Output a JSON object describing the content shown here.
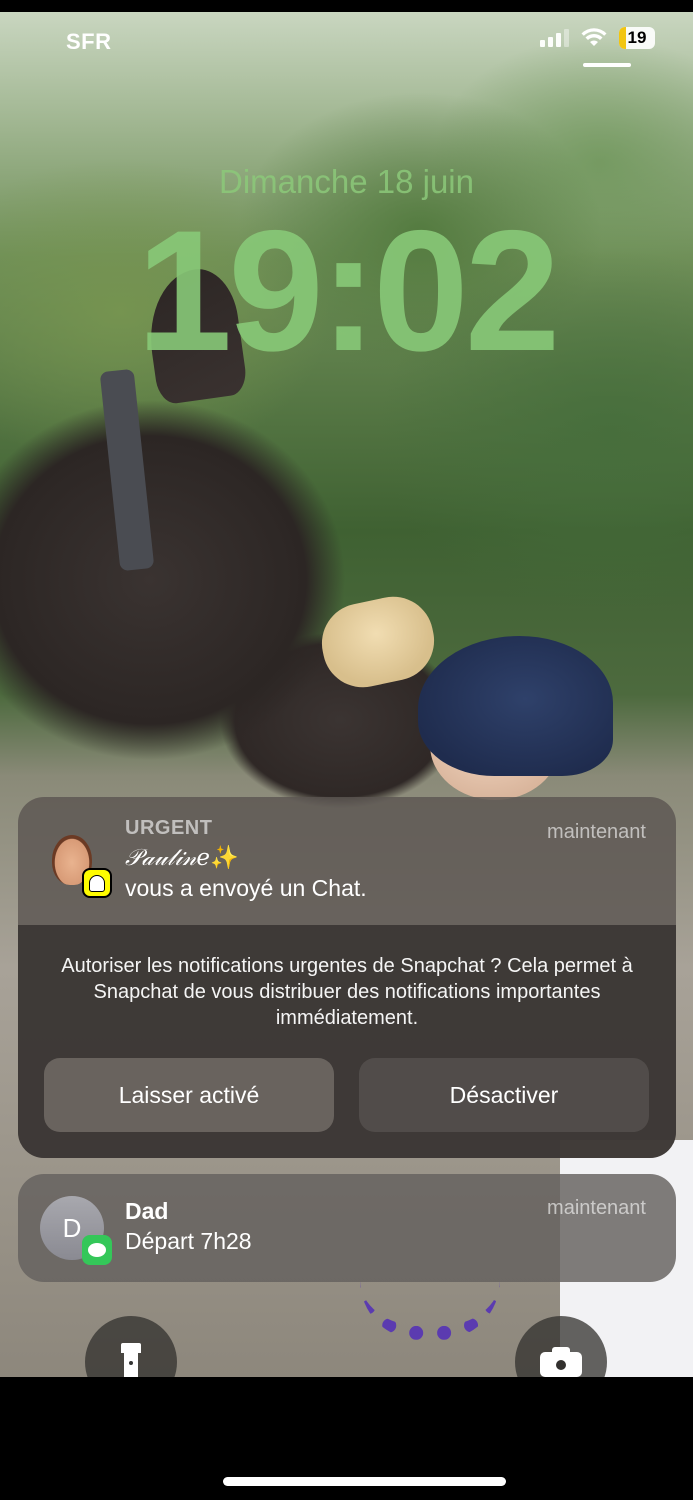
{
  "status_bar": {
    "carrier": "SFR",
    "battery": "19",
    "battery_level": 0.19,
    "battery_color": "#f2c511"
  },
  "lock_screen": {
    "date": "Dimanche 18 juin",
    "time": "19:02",
    "clock_color": "#88c978"
  },
  "notifications": [
    {
      "app": "Snapchat",
      "badge_icon": "snapchat-ghost-icon",
      "priority": "URGENT",
      "time": "maintenant",
      "sender": "𝒫𝒶𝓊𝓁𝒾𝓃𝑒",
      "sender_emoji": "✨",
      "message": "vous a envoyé un Chat.",
      "prompt": "Autoriser les notifications urgentes de Snapchat ? Cela permet à Snapchat de vous distribuer des notifications importantes immédiatement.",
      "buttons": {
        "keep": "Laisser activé",
        "disable": "Désactiver"
      }
    },
    {
      "app": "Messages",
      "badge_icon": "messages-bubble-icon",
      "avatar_initial": "D",
      "sender": "Dad",
      "time": "maintenant",
      "message": "Départ 7h28"
    }
  ],
  "controls": {
    "left": "flashlight-icon",
    "right": "camera-icon"
  }
}
